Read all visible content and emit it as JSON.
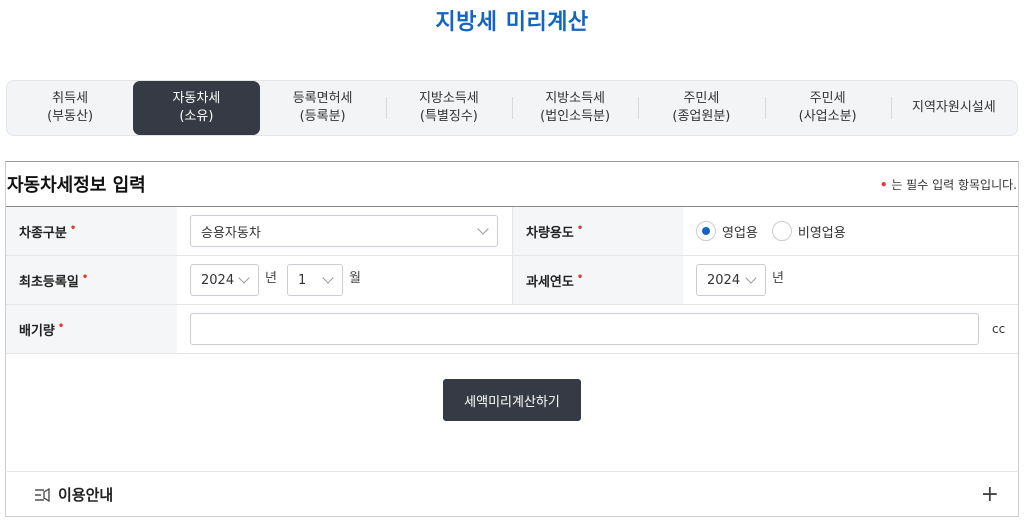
{
  "page_title": "지방세 미리계산",
  "tabs": [
    {
      "line1": "취득세",
      "line2": "(부동산)"
    },
    {
      "line1": "자동차세",
      "line2": "(소유)"
    },
    {
      "line1": "등록면허세",
      "line2": "(등록분)"
    },
    {
      "line1": "지방소득세",
      "line2": "(특별징수)"
    },
    {
      "line1": "지방소득세",
      "line2": "(법인소득분)"
    },
    {
      "line1": "주민세",
      "line2": "(종업원분)"
    },
    {
      "line1": "주민세",
      "line2": "(사업소분)"
    },
    {
      "line1": "지역자원시설세",
      "line2": ""
    }
  ],
  "active_tab_index": 1,
  "form": {
    "title": "자동차세정보 입력",
    "required_dot": "•",
    "required_note": "는 필수 입력 항목입니다.",
    "vehicle_type_label": "차종구분",
    "vehicle_type_value": "승용자동차",
    "vehicle_use_label": "차량용도",
    "use_options": [
      "영업용",
      "비영업용"
    ],
    "use_selected": "영업용",
    "first_reg_label": "최초등록일",
    "first_reg_year": "2024",
    "year_unit": "년",
    "first_reg_month": "1",
    "month_unit": "월",
    "tax_year_label": "과세연도",
    "tax_year_value": "2024",
    "displacement_label": "배기량",
    "displacement_value": "",
    "displacement_unit": "cc",
    "required_mark": "•",
    "calc_button": "세액미리계산하기"
  },
  "guide": {
    "label": "이용안내",
    "expand_symbol": "+"
  },
  "colors": {
    "title_blue": "#1565c0",
    "dark_button": "#363a45",
    "required_red": "#e53935"
  }
}
